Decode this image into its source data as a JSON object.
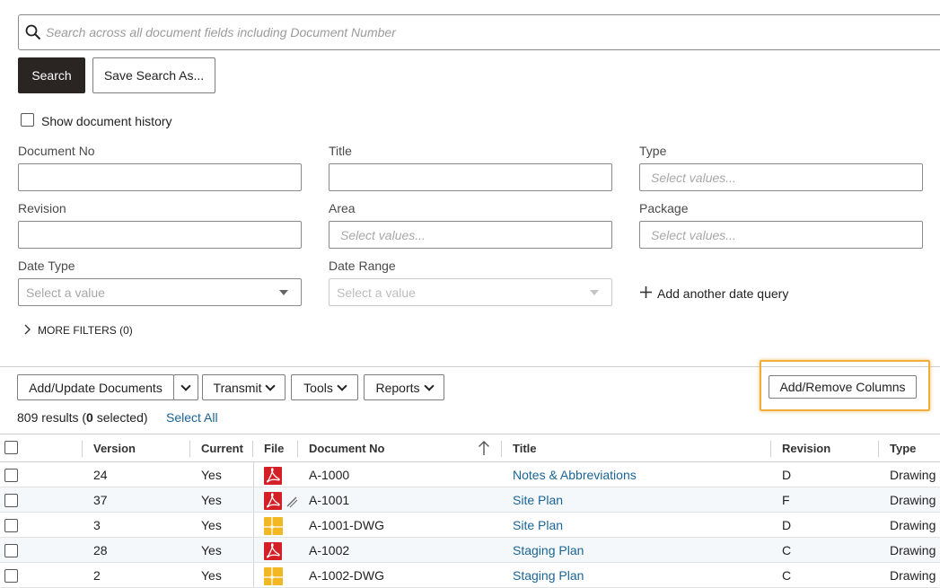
{
  "search": {
    "placeholder": "Search across all document fields including Document Number",
    "search_label": "Search",
    "save_label": "Save Search As..."
  },
  "history": {
    "label": "Show document history"
  },
  "filters": {
    "document_no": {
      "label": "Document No"
    },
    "title": {
      "label": "Title"
    },
    "type": {
      "label": "Type",
      "placeholder": "Select values..."
    },
    "revision": {
      "label": "Revision"
    },
    "area": {
      "label": "Area",
      "placeholder": "Select values..."
    },
    "package": {
      "label": "Package",
      "placeholder": "Select values..."
    },
    "date_type": {
      "label": "Date Type",
      "placeholder": "Select a value"
    },
    "date_range": {
      "label": "Date Range",
      "placeholder": "Select a value"
    },
    "add_date_query": "Add another date query",
    "more_filters": "MORE FILTERS (0)"
  },
  "toolbar": {
    "add_update": "Add/Update Documents",
    "transmit": "Transmit",
    "tools": "Tools",
    "reports": "Reports",
    "add_remove_columns": "Add/Remove Columns"
  },
  "results": {
    "count": "809",
    "count_suffix": " results (",
    "selected": "0",
    "selected_suffix": " selected)",
    "select_all": "Select All"
  },
  "table": {
    "columns": [
      "Version",
      "Current",
      "File",
      "Document No",
      "Title",
      "Revision",
      "Type"
    ],
    "rows": [
      {
        "version": "24",
        "current": "Yes",
        "file": "pdf",
        "doc_no": "A-1000",
        "title": "Notes & Abbreviations",
        "revision": "D",
        "type": "Drawing",
        "markup": false
      },
      {
        "version": "37",
        "current": "Yes",
        "file": "pdf",
        "doc_no": "A-1001",
        "title": "Site Plan",
        "revision": "F",
        "type": "Drawing",
        "markup": true
      },
      {
        "version": "3",
        "current": "Yes",
        "file": "dwg",
        "doc_no": "A-1001-DWG",
        "title": "Site Plan",
        "revision": "D",
        "type": "Drawing",
        "markup": false
      },
      {
        "version": "28",
        "current": "Yes",
        "file": "pdf",
        "doc_no": "A-1002",
        "title": "Staging Plan",
        "revision": "C",
        "type": "Drawing",
        "markup": false
      },
      {
        "version": "2",
        "current": "Yes",
        "file": "dwg",
        "doc_no": "A-1002-DWG",
        "title": "Staging Plan",
        "revision": "C",
        "type": "Drawing",
        "markup": false
      }
    ]
  },
  "colors": {
    "highlight": "#f0ad3b",
    "link": "#1a6496",
    "primary_button": "#2a2523",
    "pdf_icon": "#d31f25",
    "dwg_icon": "#f2b824"
  }
}
